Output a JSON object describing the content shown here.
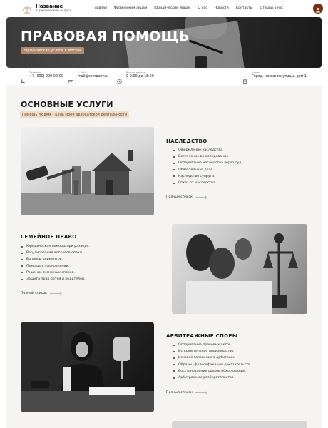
{
  "header": {
    "logo_name": "Название",
    "logo_sub": "Юридические услуги",
    "nav": [
      {
        "label": "Главная"
      },
      {
        "label": "Физическим лицам"
      },
      {
        "label": "Юридическим лицам"
      },
      {
        "label": "О нас"
      },
      {
        "label": "Новости"
      },
      {
        "label": "Контакты"
      },
      {
        "label": "Отзывы о нас"
      }
    ],
    "accent": "#7a2e12"
  },
  "hero": {
    "title": "ПРАВОВАЯ ПОМОЩЬ",
    "badge": "Юридические услуги в Москве"
  },
  "info": {
    "phone_label": "Телефон",
    "phone_value": "+7 (000) 000-00-00",
    "email_label": "E-Mail",
    "email_value": "mail@company.ru",
    "hours_label": "Режим работы",
    "hours_value": "С 9:00 до 18:00",
    "address_label": "Адрес",
    "address_value": "Город, название улицы, дом 1"
  },
  "services": {
    "title": "ОСНОВНЫЕ УСЛУГИ",
    "subtitle": "Помощь людям – цель моей адвокатской деятельности",
    "items": [
      {
        "title": "НАСЛЕДСТВО",
        "list": [
          "Оформление наследства.",
          "Вступление в наследование.",
          "Оспаривание наследства через суд.",
          "Обязательная доля.",
          "Наследство супруга.",
          "Отказ от наследства."
        ],
        "more": "Полный список",
        "image": "house-model-gavel-photo"
      },
      {
        "title": "СЕМЕЙНОЕ ПРАВО",
        "list": [
          "Юридическая помощь при разводе.",
          "Регулирование вопросов опеки",
          "Вопросы алиментов.",
          "Помощь в усыновлении.",
          "Решение семейных споров.",
          "Защита прав детей и родителей."
        ],
        "more": "Полный список",
        "image": "family-lawyer-themis-photo"
      },
      {
        "title": "АРБИТРАЖНЫЕ СПОРЫ",
        "list": [
          "Оспаривание правовых актов.",
          "Исполнительное производство.",
          "Исковое заявление в арбитраж.",
          "Образец фальсификации доказательств.",
          "Восстановление сроков обжалования.",
          "Арбитражное разбирательство"
        ],
        "more": "Полный список",
        "image": "woman-lawyer-desk-photo"
      }
    ]
  }
}
